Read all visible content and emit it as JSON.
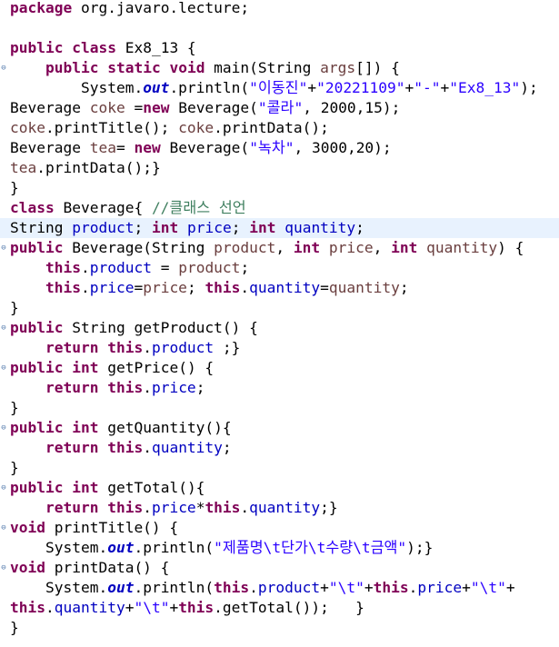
{
  "editor": {
    "gutter_icon": "⊖",
    "lines": [
      {
        "fold": false,
        "hl": false,
        "tokens": [
          [
            "kw",
            "package"
          ],
          [
            "p",
            " org.javaro.lecture;"
          ]
        ]
      },
      {
        "fold": false,
        "hl": false,
        "tokens": []
      },
      {
        "fold": false,
        "hl": false,
        "tokens": [
          [
            "kw",
            "public"
          ],
          [
            "p",
            " "
          ],
          [
            "kw",
            "class"
          ],
          [
            "p",
            " Ex8_13 {"
          ]
        ]
      },
      {
        "fold": true,
        "hl": false,
        "tokens": [
          [
            "p",
            "    "
          ],
          [
            "kw",
            "public"
          ],
          [
            "p",
            " "
          ],
          [
            "kw",
            "static"
          ],
          [
            "p",
            " "
          ],
          [
            "kw",
            "void"
          ],
          [
            "p",
            " main(String "
          ],
          [
            "var",
            "args"
          ],
          [
            "p",
            "[]) {"
          ]
        ]
      },
      {
        "fold": false,
        "hl": false,
        "tokens": [
          [
            "p",
            "        System."
          ],
          [
            "sfld",
            "out"
          ],
          [
            "p",
            ".println("
          ],
          [
            "str",
            "\"이동진\""
          ],
          [
            "p",
            "+"
          ],
          [
            "str",
            "\"20221109\""
          ],
          [
            "p",
            "+"
          ],
          [
            "str",
            "\"-\""
          ],
          [
            "p",
            "+"
          ],
          [
            "str",
            "\"Ex8_13\""
          ],
          [
            "p",
            ");"
          ]
        ]
      },
      {
        "fold": false,
        "hl": false,
        "tokens": [
          [
            "p",
            "Beverage "
          ],
          [
            "var",
            "coke"
          ],
          [
            "p",
            " ="
          ],
          [
            "kw",
            "new"
          ],
          [
            "p",
            " Beverage("
          ],
          [
            "str",
            "\"콜라\""
          ],
          [
            "p",
            ", 2000,15);"
          ]
        ]
      },
      {
        "fold": false,
        "hl": false,
        "tokens": [
          [
            "var",
            "coke"
          ],
          [
            "p",
            ".printTitle(); "
          ],
          [
            "var",
            "coke"
          ],
          [
            "p",
            ".printData();"
          ]
        ]
      },
      {
        "fold": false,
        "hl": false,
        "tokens": [
          [
            "p",
            "Beverage "
          ],
          [
            "var",
            "tea"
          ],
          [
            "p",
            "= "
          ],
          [
            "kw",
            "new"
          ],
          [
            "p",
            " Beverage("
          ],
          [
            "str",
            "\"녹차\""
          ],
          [
            "p",
            ", 3000,20);"
          ]
        ]
      },
      {
        "fold": false,
        "hl": false,
        "tokens": [
          [
            "var",
            "tea"
          ],
          [
            "p",
            ".printData();}"
          ]
        ]
      },
      {
        "fold": false,
        "hl": false,
        "tokens": [
          [
            "p",
            "}"
          ]
        ]
      },
      {
        "fold": false,
        "hl": false,
        "tokens": [
          [
            "kw",
            "class"
          ],
          [
            "p",
            " Beverage{ "
          ],
          [
            "cmt",
            "//클래스 선언"
          ]
        ]
      },
      {
        "fold": false,
        "hl": true,
        "tokens": [
          [
            "p",
            "String "
          ],
          [
            "fld",
            "product"
          ],
          [
            "p",
            "; "
          ],
          [
            "kw",
            "int"
          ],
          [
            "p",
            " "
          ],
          [
            "fld",
            "price"
          ],
          [
            "p",
            "; "
          ],
          [
            "kw",
            "int"
          ],
          [
            "p",
            " "
          ],
          [
            "fld",
            "quantity"
          ],
          [
            "p",
            ";"
          ]
        ]
      },
      {
        "fold": true,
        "hl": false,
        "tokens": [
          [
            "kw",
            "public"
          ],
          [
            "p",
            " Beverage(String "
          ],
          [
            "var",
            "product"
          ],
          [
            "p",
            ", "
          ],
          [
            "kw",
            "int"
          ],
          [
            "p",
            " "
          ],
          [
            "var",
            "price"
          ],
          [
            "p",
            ", "
          ],
          [
            "kw",
            "int"
          ],
          [
            "p",
            " "
          ],
          [
            "var",
            "quantity"
          ],
          [
            "p",
            ") {"
          ]
        ]
      },
      {
        "fold": false,
        "hl": false,
        "tokens": [
          [
            "p",
            "    "
          ],
          [
            "kw",
            "this"
          ],
          [
            "p",
            "."
          ],
          [
            "fld",
            "product"
          ],
          [
            "p",
            " = "
          ],
          [
            "var",
            "product"
          ],
          [
            "p",
            ";"
          ]
        ]
      },
      {
        "fold": false,
        "hl": false,
        "tokens": [
          [
            "p",
            "    "
          ],
          [
            "kw",
            "this"
          ],
          [
            "p",
            "."
          ],
          [
            "fld",
            "price"
          ],
          [
            "p",
            "="
          ],
          [
            "var",
            "price"
          ],
          [
            "p",
            "; "
          ],
          [
            "kw",
            "this"
          ],
          [
            "p",
            "."
          ],
          [
            "fld",
            "quantity"
          ],
          [
            "p",
            "="
          ],
          [
            "var",
            "quantity"
          ],
          [
            "p",
            ";"
          ]
        ]
      },
      {
        "fold": false,
        "hl": false,
        "tokens": [
          [
            "p",
            "}"
          ]
        ]
      },
      {
        "fold": true,
        "hl": false,
        "tokens": [
          [
            "kw",
            "public"
          ],
          [
            "p",
            " String getProduct() {"
          ]
        ]
      },
      {
        "fold": false,
        "hl": false,
        "tokens": [
          [
            "p",
            "    "
          ],
          [
            "kw",
            "return"
          ],
          [
            "p",
            " "
          ],
          [
            "kw",
            "this"
          ],
          [
            "p",
            "."
          ],
          [
            "fld",
            "product"
          ],
          [
            "p",
            " ;}"
          ]
        ]
      },
      {
        "fold": true,
        "hl": false,
        "tokens": [
          [
            "kw",
            "public"
          ],
          [
            "p",
            " "
          ],
          [
            "kw",
            "int"
          ],
          [
            "p",
            " getPrice() {"
          ]
        ]
      },
      {
        "fold": false,
        "hl": false,
        "tokens": [
          [
            "p",
            "    "
          ],
          [
            "kw",
            "return"
          ],
          [
            "p",
            " "
          ],
          [
            "kw",
            "this"
          ],
          [
            "p",
            "."
          ],
          [
            "fld",
            "price"
          ],
          [
            "p",
            ";"
          ]
        ]
      },
      {
        "fold": false,
        "hl": false,
        "tokens": [
          [
            "p",
            "}"
          ]
        ]
      },
      {
        "fold": true,
        "hl": false,
        "tokens": [
          [
            "kw",
            "public"
          ],
          [
            "p",
            " "
          ],
          [
            "kw",
            "int"
          ],
          [
            "p",
            " getQuantity(){"
          ]
        ]
      },
      {
        "fold": false,
        "hl": false,
        "tokens": [
          [
            "p",
            "    "
          ],
          [
            "kw",
            "return"
          ],
          [
            "p",
            " "
          ],
          [
            "kw",
            "this"
          ],
          [
            "p",
            "."
          ],
          [
            "fld",
            "quantity"
          ],
          [
            "p",
            ";"
          ]
        ]
      },
      {
        "fold": false,
        "hl": false,
        "tokens": [
          [
            "p",
            "}"
          ]
        ]
      },
      {
        "fold": true,
        "hl": false,
        "tokens": [
          [
            "kw",
            "public"
          ],
          [
            "p",
            " "
          ],
          [
            "kw",
            "int"
          ],
          [
            "p",
            " getTotal(){"
          ]
        ]
      },
      {
        "fold": false,
        "hl": false,
        "tokens": [
          [
            "p",
            "    "
          ],
          [
            "kw",
            "return"
          ],
          [
            "p",
            " "
          ],
          [
            "kw",
            "this"
          ],
          [
            "p",
            "."
          ],
          [
            "fld",
            "price"
          ],
          [
            "p",
            "*"
          ],
          [
            "kw",
            "this"
          ],
          [
            "p",
            "."
          ],
          [
            "fld",
            "quantity"
          ],
          [
            "p",
            ";}"
          ]
        ]
      },
      {
        "fold": true,
        "hl": false,
        "tokens": [
          [
            "kw",
            "void"
          ],
          [
            "p",
            " printTitle() {"
          ]
        ]
      },
      {
        "fold": false,
        "hl": false,
        "tokens": [
          [
            "p",
            "    System."
          ],
          [
            "sfld",
            "out"
          ],
          [
            "p",
            ".println("
          ],
          [
            "str",
            "\"제품명\\t단가\\t수량\\t금액\""
          ],
          [
            "p",
            ");}"
          ]
        ]
      },
      {
        "fold": true,
        "hl": false,
        "tokens": [
          [
            "kw",
            "void"
          ],
          [
            "p",
            " printData() {"
          ]
        ]
      },
      {
        "fold": false,
        "hl": false,
        "tokens": [
          [
            "p",
            "    System."
          ],
          [
            "sfld",
            "out"
          ],
          [
            "p",
            ".println("
          ],
          [
            "kw",
            "this"
          ],
          [
            "p",
            "."
          ],
          [
            "fld",
            "product"
          ],
          [
            "p",
            "+"
          ],
          [
            "str",
            "\"\\t\""
          ],
          [
            "p",
            "+"
          ],
          [
            "kw",
            "this"
          ],
          [
            "p",
            "."
          ],
          [
            "fld",
            "price"
          ],
          [
            "p",
            "+"
          ],
          [
            "str",
            "\"\\t\""
          ],
          [
            "p",
            "+"
          ]
        ]
      },
      {
        "fold": false,
        "hl": false,
        "tokens": [
          [
            "kw",
            "this"
          ],
          [
            "p",
            "."
          ],
          [
            "fld",
            "quantity"
          ],
          [
            "p",
            "+"
          ],
          [
            "str",
            "\"\\t\""
          ],
          [
            "p",
            "+"
          ],
          [
            "kw",
            "this"
          ],
          [
            "p",
            ".getTotal());   }"
          ]
        ]
      },
      {
        "fold": false,
        "hl": false,
        "tokens": [
          [
            "p",
            "}"
          ]
        ]
      }
    ]
  }
}
